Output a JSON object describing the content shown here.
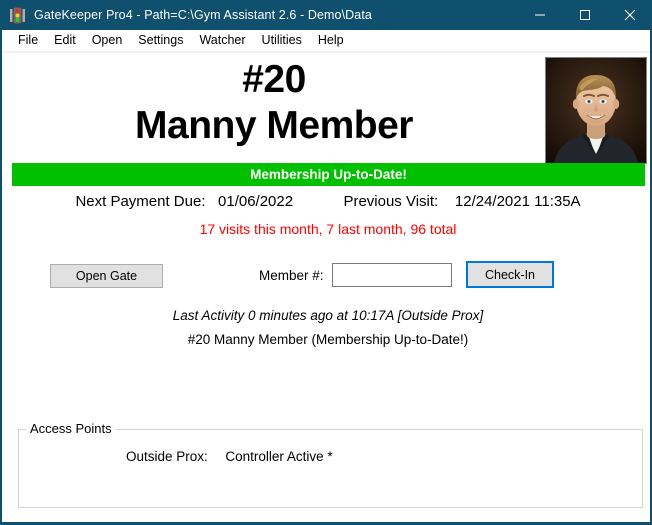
{
  "window": {
    "title": "GateKeeper Pro4 - Path=C:\\Gym Assistant 2.6 - Demo\\Data",
    "icon": "traffic-light-icon",
    "titlebar_color": "#10506f",
    "controls": {
      "minimize": "minimize-icon",
      "maximize": "maximize-icon",
      "close": "close-icon"
    }
  },
  "menubar": {
    "items": [
      {
        "label": "File"
      },
      {
        "label": "Edit"
      },
      {
        "label": "Open"
      },
      {
        "label": "Settings"
      },
      {
        "label": "Watcher"
      },
      {
        "label": "Utilities"
      },
      {
        "label": "Help"
      }
    ]
  },
  "member": {
    "id": "#20",
    "name": "Manny Member",
    "photo_alt": "member-photo",
    "status_text": "Membership Up-to-Date!",
    "status_color": "#00c000",
    "next_payment_label": "Next Payment Due:",
    "next_payment_value": "01/06/2022",
    "previous_visit_label": "Previous Visit:",
    "previous_visit_value": "12/24/2021 11:35A",
    "visits_summary": "17 visits this month, 7 last month, 96 total",
    "visits_color": "#ff0000"
  },
  "controls": {
    "open_gate_label": "Open Gate",
    "member_number_label": "Member #:",
    "member_number_value": "",
    "member_number_placeholder": "",
    "checkin_label": "Check-In"
  },
  "activity": {
    "last_activity": "Last Activity 0 minutes ago at 10:17A [Outside Prox]",
    "detail": "#20 Manny Member (Membership Up-to-Date!)"
  },
  "access_points": {
    "group_title": "Access Points",
    "rows": [
      {
        "name": "Outside Prox:",
        "status": "Controller Active *"
      }
    ]
  }
}
